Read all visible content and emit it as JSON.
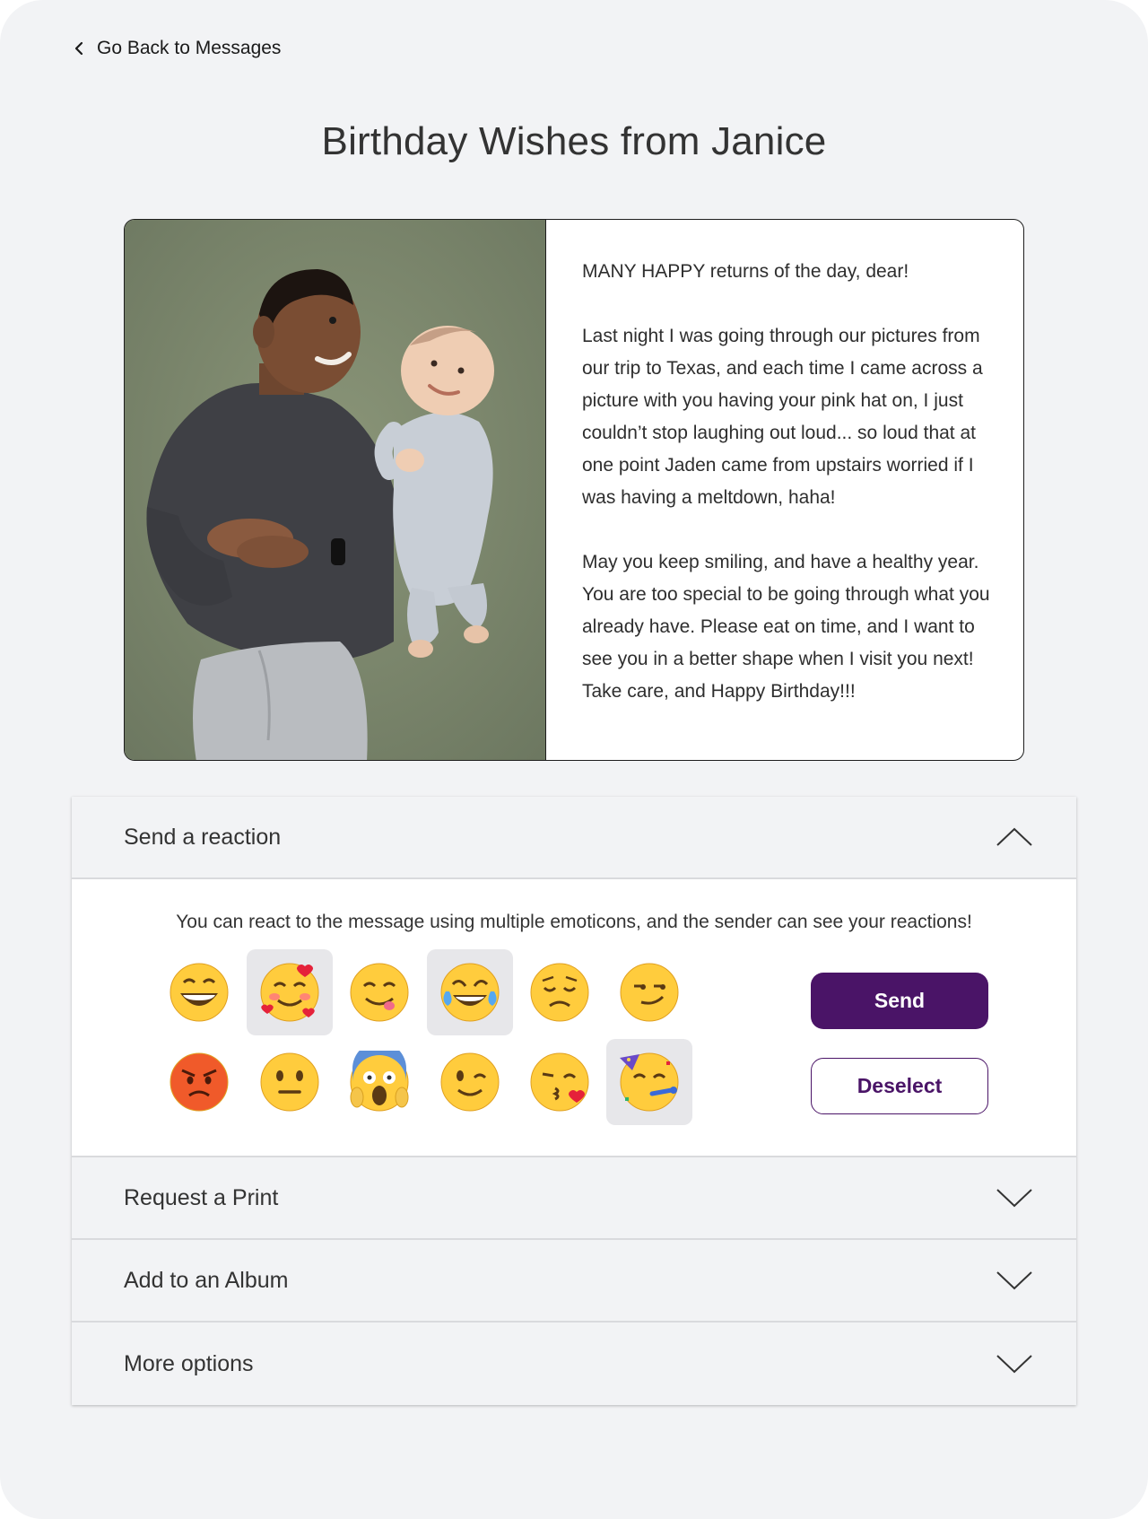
{
  "nav": {
    "back_label": "Go Back to Messages",
    "back_icon": "chevron-left-icon"
  },
  "page": {
    "title": "Birthday Wishes from Janice"
  },
  "message": {
    "image_alt": "Photo of a smiling man lying beside a smiling baby on a green carpet",
    "paragraphs": [
      "MANY HAPPY returns of the day, dear!",
      "Last night I was going through our pictures from our trip to Texas, and each time I came across a picture with you having your pink hat on, I just couldn’t stop laughing out loud... so loud that at one point Jaden came from upstairs worried if I was having a meltdown, haha!",
      "May you keep smiling, and have a healthy year. You are too special to be going through what you already have. Please eat on time, and I want to see you in a better shape when I visit you next! Take care, and Happy Birthday!!!"
    ]
  },
  "reaction": {
    "header": "Send a reaction",
    "expanded": true,
    "hint": "You can react to the message using multiple emoticons, and the sender can see your reactions!",
    "emojis": [
      {
        "name": "grinning-face",
        "selected": false
      },
      {
        "name": "smiling-face-with-hearts",
        "selected": true
      },
      {
        "name": "face-savoring-food",
        "selected": false
      },
      {
        "name": "face-with-tears-of-joy",
        "selected": true
      },
      {
        "name": "disappointed-face",
        "selected": false
      },
      {
        "name": "smirking-face",
        "selected": false
      },
      {
        "name": "angry-face",
        "selected": false
      },
      {
        "name": "neutral-face",
        "selected": false
      },
      {
        "name": "face-screaming-in-fear",
        "selected": false
      },
      {
        "name": "winking-face",
        "selected": false
      },
      {
        "name": "face-blowing-a-kiss",
        "selected": false
      },
      {
        "name": "partying-face",
        "selected": true
      }
    ],
    "send_label": "Send",
    "deselect_label": "Deselect"
  },
  "sections": [
    {
      "label": "Request a Print",
      "expanded": false
    },
    {
      "label": "Add to an Album",
      "expanded": false
    },
    {
      "label": "More options",
      "expanded": false
    }
  ],
  "colors": {
    "primary": "#4a1467",
    "page_bg": "#f2f3f5",
    "selected_emoji_bg": "#e7e7ea"
  }
}
